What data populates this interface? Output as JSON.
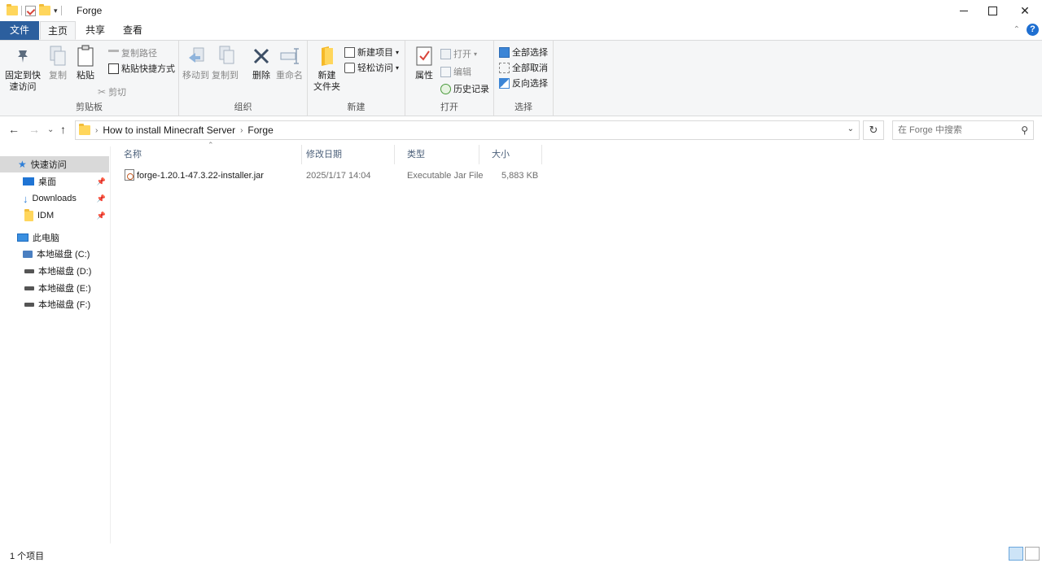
{
  "window": {
    "title": "Forge"
  },
  "tabs": {
    "file": "文件",
    "home": "主页",
    "share": "共享",
    "view": "查看"
  },
  "ribbon": {
    "clipboard": {
      "label": "剪贴板",
      "pin_line1": "固定到快",
      "pin_line2": "速访问",
      "copy": "复制",
      "paste": "粘贴",
      "copy_path": "复制路径",
      "paste_shortcut": "粘贴快捷方式",
      "cut": "剪切"
    },
    "organize": {
      "label": "组织",
      "move_to": "移动到",
      "copy_to": "复制到",
      "delete": "删除",
      "rename": "重命名"
    },
    "new": {
      "label": "新建",
      "new_folder_line1": "新建",
      "new_folder_line2": "文件夹",
      "new_item": "新建项目",
      "easy_access": "轻松访问"
    },
    "open": {
      "label": "打开",
      "properties": "属性",
      "open": "打开",
      "edit": "编辑",
      "history": "历史记录"
    },
    "select": {
      "label": "选择",
      "select_all": "全部选择",
      "select_none": "全部取消",
      "invert": "反向选择"
    }
  },
  "address": {
    "crumbs": [
      "How to install Minecraft Server",
      "Forge"
    ]
  },
  "search": {
    "placeholder": "在 Forge 中搜索"
  },
  "nav": {
    "quick_access": "快速访问",
    "desktop": "桌面",
    "downloads": "Downloads",
    "idm": "IDM",
    "this_pc": "此电脑",
    "drive_c": "本地磁盘 (C:)",
    "drive_d": "本地磁盘 (D:)",
    "drive_e": "本地磁盘 (E:)",
    "drive_f": "本地磁盘 (F:)"
  },
  "columns": {
    "name": "名称",
    "modified": "修改日期",
    "type": "类型",
    "size": "大小"
  },
  "files": [
    {
      "name": "forge-1.20.1-47.3.22-installer.jar",
      "modified": "2025/1/17 14:04",
      "type": "Executable Jar File",
      "size": "5,883 KB"
    }
  ],
  "status": {
    "count": "1 个项目"
  },
  "colors": {
    "file_tab": "#2c5f9e",
    "accent": "#2f7fd8",
    "folder": "#ffd65c"
  }
}
